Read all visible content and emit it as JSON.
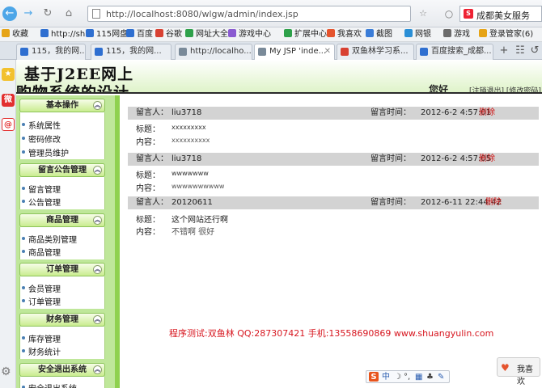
{
  "browser": {
    "url": "http://localhost:8080/wlgw/admin/index.jsp",
    "search_text": "成都美女服务",
    "bookmarks": [
      {
        "label": "收藏",
        "color": "#e6a417"
      },
      {
        "label": "http://sh",
        "color": "#2f6fd0"
      },
      {
        "label": "115网盘",
        "color": "#2f6fd0"
      },
      {
        "label": "百度",
        "color": "#2f6fd0"
      },
      {
        "label": "谷歌",
        "color": "#d84132"
      },
      {
        "label": "网址大全",
        "color": "#2ea14a"
      },
      {
        "label": "游戏中心",
        "color": "#8a5bd1"
      },
      {
        "label": "扩展中心",
        "color": "#2ea14a"
      },
      {
        "label": "我喜欢",
        "color": "#e5542e"
      },
      {
        "label": "截图",
        "color": "#3b7dd8"
      },
      {
        "label": "网银",
        "color": "#2a8fd6"
      },
      {
        "label": "游戏",
        "color": "#6b6b6b"
      },
      {
        "label": "登录管家(6)",
        "color": "#e6a417"
      }
    ],
    "tabs": [
      {
        "label": "115，我的网...",
        "color": "#2f6fd0",
        "active": false
      },
      {
        "label": "115，我的网...",
        "color": "#2f6fd0",
        "active": false
      },
      {
        "label": "http://localho...",
        "color": "#7a8a99",
        "active": false
      },
      {
        "label": "My JSP 'inde...",
        "color": "#7a8a99",
        "active": true
      },
      {
        "label": "双鱼林学习系...",
        "color": "#d84132",
        "active": false
      },
      {
        "label": "百度搜索_成都...",
        "color": "#2f6fd0",
        "active": false
      }
    ]
  },
  "header": {
    "title_line1": "基于J2EE网上",
    "title_line2": "购物系统的设计",
    "welcome": "您好",
    "links": "[注销退出] [修改密码]"
  },
  "menu": {
    "sections": [
      {
        "title": "基本操作",
        "items": [
          "系统属性",
          "密码修改",
          "管理员维护"
        ]
      },
      {
        "title": "留言公告管理",
        "items": [
          "留言管理",
          "公告管理"
        ]
      },
      {
        "title": "商品管理",
        "items": [
          "商品类别管理",
          "商品管理"
        ]
      },
      {
        "title": "订单管理",
        "items": [
          "会员管理",
          "订单管理"
        ]
      },
      {
        "title": "财务管理",
        "items": [
          "库存管理",
          "财务统计"
        ]
      },
      {
        "title": "安全退出系统",
        "items": [
          "安全退出系统"
        ]
      }
    ]
  },
  "messages": {
    "labels": {
      "author": "留言人：",
      "time": "留言时间：",
      "title": "标题：",
      "content": "内容：",
      "delete": "删除"
    },
    "items": [
      {
        "author": "liu3718",
        "time": "2012-6-2 4:57:01",
        "title": "xxxxxxxxx",
        "content": "xxxxxxxxxx"
      },
      {
        "author": "liu3718",
        "time": "2012-6-2 4:57:05",
        "title": "wwwwwww",
        "content": "wwwwwwwwww"
      },
      {
        "author": "20120611",
        "time": "2012-6-11 22:44:42",
        "title": "这个网站还行啊",
        "content": "不错啊  很好"
      }
    ]
  },
  "footer_note": "程序测试:双鱼林 QQ:287307421 手机:13558690869 www.shuangyulin.com",
  "ime": {
    "logo": "S",
    "mode": "中"
  },
  "like_button": "我喜欢"
}
